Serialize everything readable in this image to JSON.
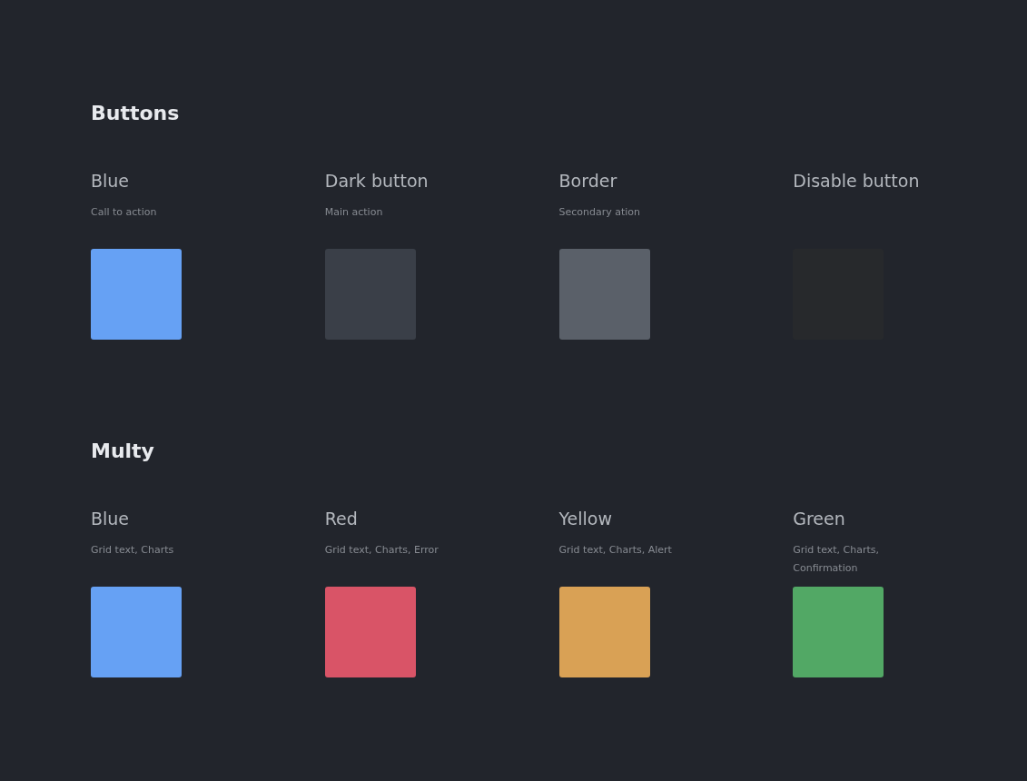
{
  "sections": [
    {
      "title": "Buttons",
      "swatches": [
        {
          "name": "Blue",
          "description": "Call to action",
          "color": "#66a1f4"
        },
        {
          "name": "Dark button",
          "description": "Main action",
          "color": "#3a3f48"
        },
        {
          "name": "Border",
          "description": "Secondary ation",
          "color": "#5a6069"
        },
        {
          "name": "Disable button",
          "color": "#27292c"
        }
      ]
    },
    {
      "title": "Multy",
      "swatches": [
        {
          "name": "Blue",
          "description": "Grid text, Charts",
          "color": "#66a1f4"
        },
        {
          "name": "Red",
          "description": "Grid text, Charts, Error",
          "color": "#d95467"
        },
        {
          "name": "Yellow",
          "description": "Grid text, Charts, Alert",
          "color": "#d9a155"
        },
        {
          "name": "Green",
          "description": "Grid text, Charts, Confirmation",
          "color": "#52a865"
        }
      ]
    }
  ]
}
